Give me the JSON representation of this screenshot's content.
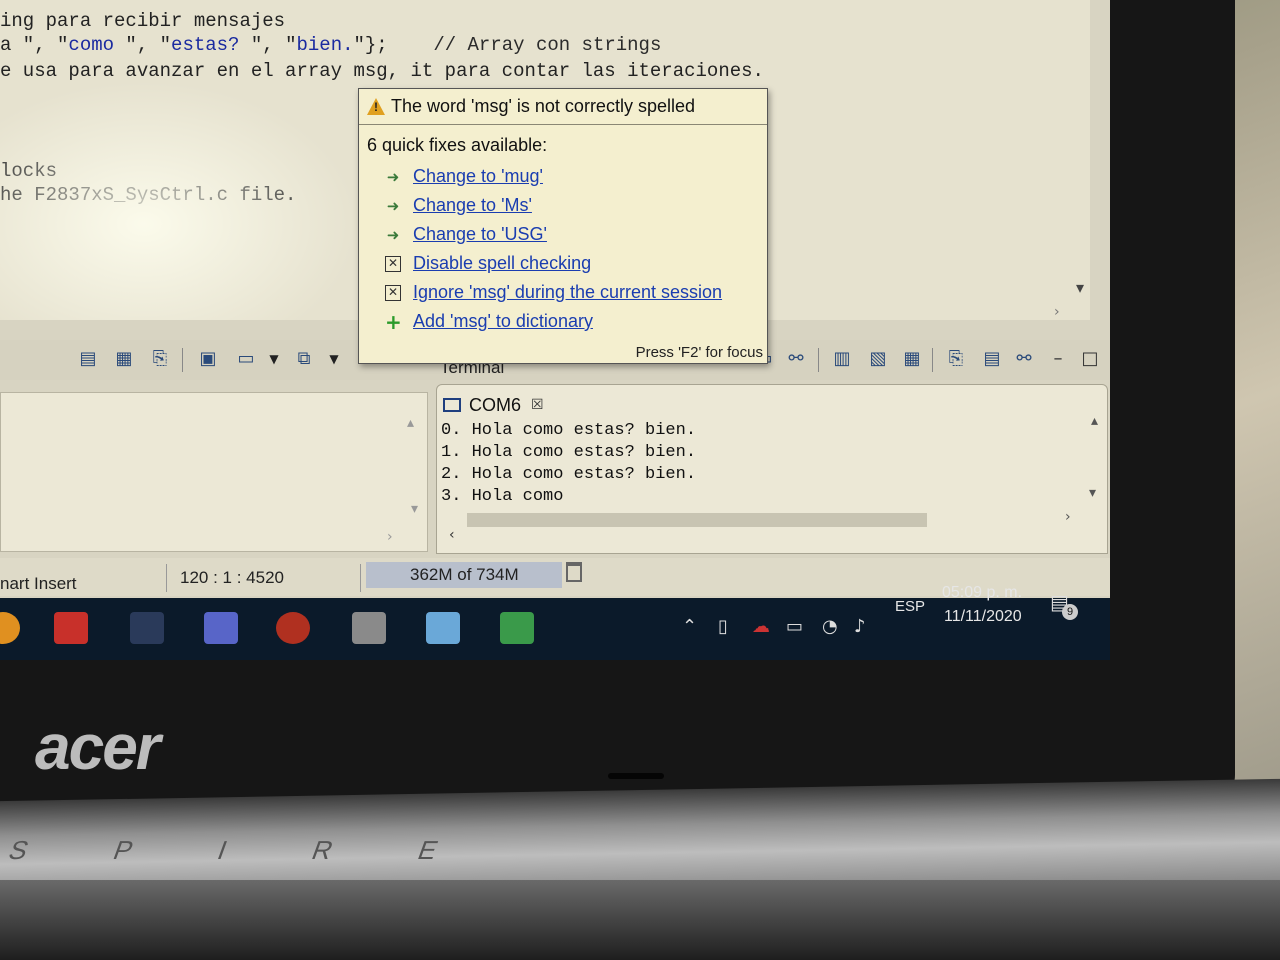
{
  "editor": {
    "line1": "ing para recibir mensajes",
    "line2_pre": "a \", \"",
    "line2_s1": "como",
    "line2_mid1": " \", \"",
    "line2_s2": "estas? ",
    "line2_mid2": "\", \"",
    "line2_s3": "bien.",
    "line2_post": "\"};",
    "line2_comment": "    // Array con strings",
    "line3": "e usa para avanzar en el array msg, it para contar las iteraciones.",
    "line4": "locks",
    "line5": "he F2837xS_SysCtrl.c file."
  },
  "popup": {
    "title": "The word 'msg' is not correctly spelled",
    "count": "6 quick fixes available:",
    "fixes": [
      {
        "label": "Change to 'mug'",
        "icon": "change-icon"
      },
      {
        "label": "Change to 'Ms'",
        "icon": "change-icon"
      },
      {
        "label": "Change to 'USG'",
        "icon": "change-icon"
      },
      {
        "label": "Disable spell checking",
        "icon": "checkbox-x-icon"
      },
      {
        "label": "Ignore 'msg' during the current session",
        "icon": "checkbox-x-icon"
      },
      {
        "label": "Add 'msg' to dictionary",
        "icon": "plus-icon"
      }
    ],
    "footer": "Press 'F2' for focus"
  },
  "terminal": {
    "view_title": "Terminal",
    "tab": "COM6",
    "lines": [
      "0. Hola como estas? bien.",
      "1. Hola como estas? bien.",
      "2. Hola como estas? bien.",
      "3. Hola como"
    ]
  },
  "statusbar": {
    "mode": "nart Insert",
    "position": "120 : 1 : 4520",
    "heap": "362M of 734M"
  },
  "taskbar": {
    "language": "ESP",
    "time": "05:09 p. m.",
    "date": "11/11/2020",
    "notification_count": "9"
  },
  "hardware": {
    "brand": "acer",
    "model_text": "S P I R E"
  },
  "colors": {
    "link": "#1a3db0",
    "popup_bg": "#f4efcf",
    "taskbar": "#0b1a2a",
    "string_literal": "#1a2aa0"
  }
}
